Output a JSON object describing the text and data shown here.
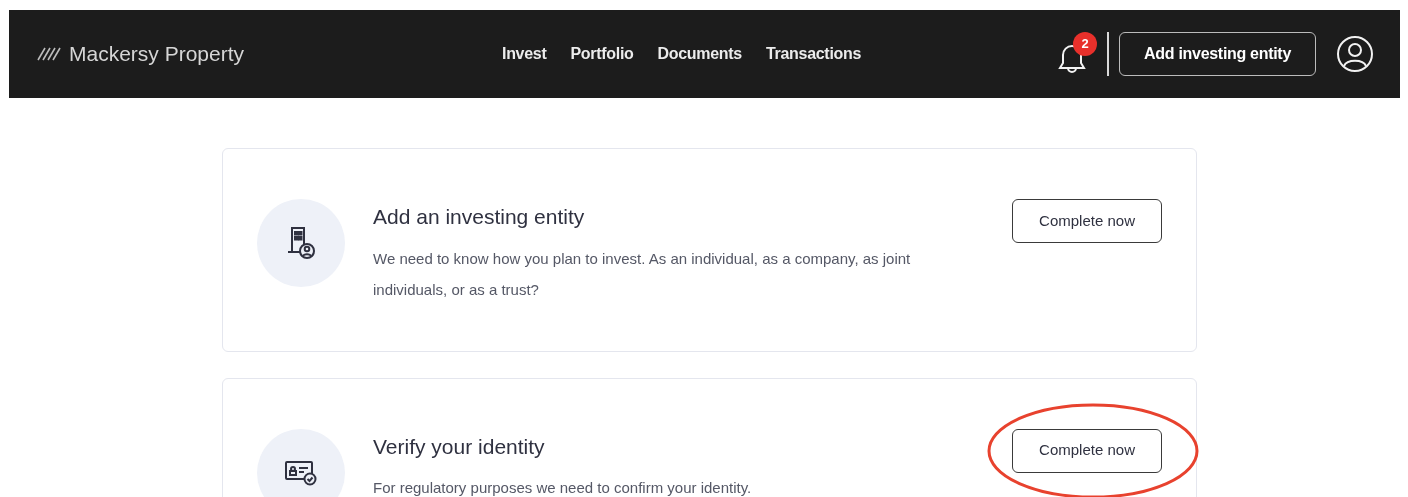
{
  "header": {
    "brand": "Mackersy Property",
    "nav": [
      "Invest",
      "Portfolio",
      "Documents",
      "Transactions"
    ],
    "notifications": {
      "count": "2"
    },
    "add_button": "Add investing entity"
  },
  "tasks": [
    {
      "kind": "entity",
      "title": "Add an investing entity",
      "description": "We need to know how you plan to invest. As an individual, as a company, as joint individuals, or as a trust?",
      "button": "Complete now",
      "circled": false
    },
    {
      "kind": "identity",
      "title": "Verify your identity",
      "description": "For regulatory purposes we need to confirm your identity.",
      "button": "Complete now",
      "circled": true
    }
  ]
}
